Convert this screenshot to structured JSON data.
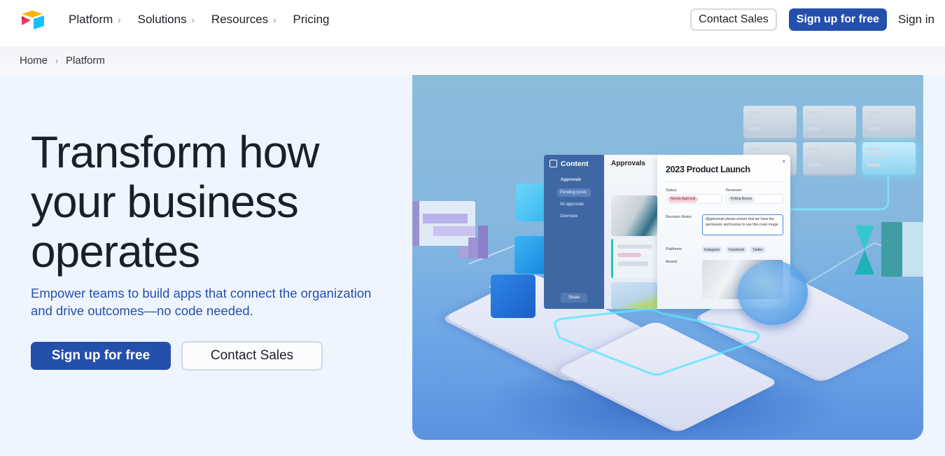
{
  "nav": {
    "logo_name": "Airtable",
    "links": [
      {
        "label": "Platform",
        "has_submenu": true
      },
      {
        "label": "Solutions",
        "has_submenu": true
      },
      {
        "label": "Resources",
        "has_submenu": true
      },
      {
        "label": "Pricing",
        "has_submenu": false
      }
    ],
    "contact_sales": "Contact Sales",
    "signup": "Sign up for free",
    "signin": "Sign in"
  },
  "breadcrumb": {
    "items": [
      "Home",
      "Platform"
    ],
    "separator": "›"
  },
  "hero": {
    "title_lines": [
      "Transform how",
      "your business",
      "operates"
    ],
    "subtitle": "Empower teams to build apps that connect the organization and drive outcomes—no code needed.",
    "primary_cta": "Sign up for free",
    "secondary_cta": "Contact Sales"
  },
  "illustration": {
    "sidebar": {
      "title": "Content",
      "section": "Approvals",
      "items": [
        "Pending posts",
        "All approvals",
        "Overview"
      ],
      "share": "Share"
    },
    "list": {
      "title": "Approvals"
    },
    "detail": {
      "title": "2023 Product Launch",
      "close": "×",
      "status_label": "Status",
      "status_value": "Needs Approval",
      "reviewer_label": "Reviewer",
      "reviewer_value": "Felicia Reyes",
      "notes_label": "Revision Notes",
      "notes_value": "@galcamari please ensure that we have the permission and license to use this cover image",
      "platforms_label": "Platforms",
      "platforms": [
        "Instagram",
        "Facebook",
        "Twitter"
      ],
      "assets_label": "Assets"
    }
  },
  "colors": {
    "brand_blue": "#254fad",
    "page_bg": "#eff5ff",
    "heading": "#1a1f2b",
    "logo_yellow": "#fcb400",
    "logo_red": "#e8385a",
    "logo_cyan": "#18bfff"
  }
}
